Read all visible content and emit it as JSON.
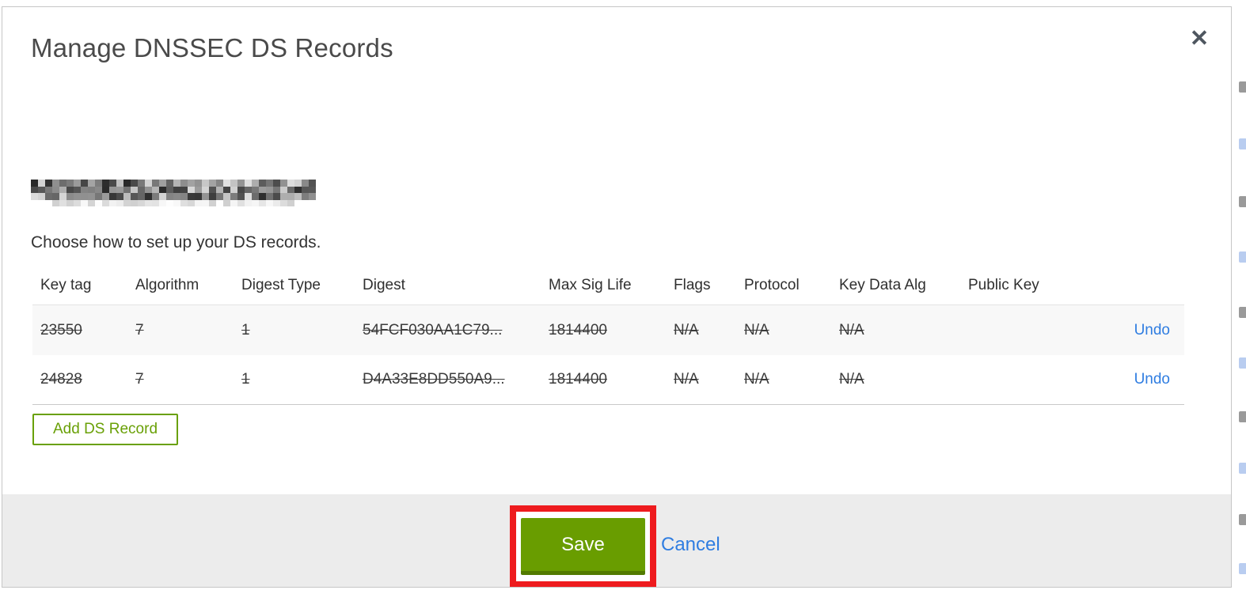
{
  "modal": {
    "title": "Manage DNSSEC DS Records",
    "close_icon": "✕",
    "domain": {
      "redacted": true
    },
    "subtitle": "Choose how to set up your DS records.",
    "table": {
      "columns": [
        "Key tag",
        "Algorithm",
        "Digest Type",
        "Digest",
        "Max Sig Life",
        "Flags",
        "Protocol",
        "Key Data Alg",
        "Public Key"
      ],
      "rows": [
        {
          "key_tag": "23550",
          "algorithm": "7",
          "digest_type": "1",
          "digest": "54FCF030AA1C79...",
          "max_sig_life": "1814400",
          "flags": "N/A",
          "protocol": "N/A",
          "key_data_alg": "N/A",
          "public_key": "",
          "action": "Undo",
          "deleted": true
        },
        {
          "key_tag": "24828",
          "algorithm": "7",
          "digest_type": "1",
          "digest": "D4A33E8DD550A9...",
          "max_sig_life": "1814400",
          "flags": "N/A",
          "protocol": "N/A",
          "key_data_alg": "N/A",
          "public_key": "",
          "action": "Undo",
          "deleted": true
        }
      ]
    },
    "add_button_label": "Add DS Record",
    "footer": {
      "save_label": "Save",
      "cancel_label": "Cancel"
    }
  },
  "annotation": {
    "type": "red-highlight-box",
    "target": "save-button"
  },
  "colors": {
    "accent-green": "#69a006",
    "save-green": "#699d00",
    "save-green-dark": "#527b00",
    "link-blue": "#2f7de1",
    "annotation-red": "#ee1b1e",
    "footer-bg": "#ececec",
    "row-alt-bg": "#f8f8f8",
    "border-gray": "#c6c6c6"
  }
}
